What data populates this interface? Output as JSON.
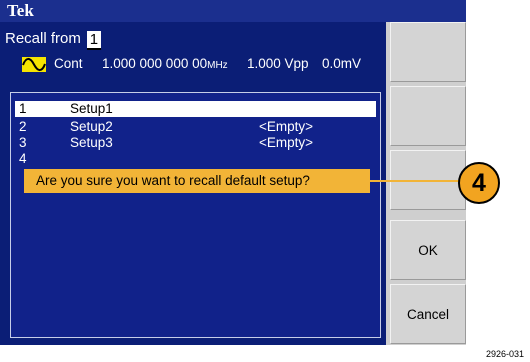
{
  "title": "Tek",
  "recall": {
    "label": "Recall from",
    "slot": "1"
  },
  "status": {
    "mode": "Cont",
    "frequency": "1.000 000 000 00",
    "frequency_unit": "MHz",
    "amplitude": "1.000 Vpp",
    "offset": "0.0mV"
  },
  "setups": [
    {
      "num": "1",
      "name": "Setup1",
      "state": ""
    },
    {
      "num": "2",
      "name": "Setup2",
      "state": "<Empty>"
    },
    {
      "num": "3",
      "name": "Setup3",
      "state": "<Empty>"
    },
    {
      "num": "4",
      "name": "",
      "state": ""
    }
  ],
  "dialog": {
    "message": "Are you sure you want to recall default setup?"
  },
  "softkeys": {
    "ok": "OK",
    "cancel": "Cancel"
  },
  "callout": "4",
  "figure_id": "2926-031",
  "colors": {
    "screen_bg": "#0b1e76",
    "dialog_bg": "#f2b437",
    "wave_icon": "#f5e400",
    "callout": "#f2a420"
  }
}
